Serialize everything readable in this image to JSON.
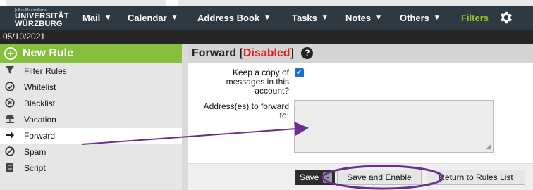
{
  "header": {
    "logo_small": "Julius-Maximilians-",
    "logo_line1": "UNIVERSITÄT",
    "logo_line2": "WÜRZBURG",
    "menu": [
      {
        "label": "Mail"
      },
      {
        "label": "Calendar"
      },
      {
        "label": "Address Book"
      },
      {
        "label": "Tasks"
      },
      {
        "label": "Notes"
      },
      {
        "label": "Others"
      },
      {
        "label": "Filters"
      }
    ],
    "caret": "▼",
    "settings_icon": "gear-icon"
  },
  "datebar": {
    "date": "05/10/2021"
  },
  "sidebar": {
    "new_rule": "New Rule",
    "items": [
      {
        "label": "Filter Rules",
        "icon": "funnel-icon",
        "active": false
      },
      {
        "label": "Whitelist",
        "icon": "check-circle-icon",
        "active": false
      },
      {
        "label": "Blacklist",
        "icon": "x-circle-icon",
        "active": false
      },
      {
        "label": "Vacation",
        "icon": "umbrella-icon",
        "active": false
      },
      {
        "label": "Forward",
        "icon": "arrow-right-icon",
        "active": true
      },
      {
        "label": "Spam",
        "icon": "ban-icon",
        "active": false
      },
      {
        "label": "Script",
        "icon": "script-icon",
        "active": false
      }
    ]
  },
  "main": {
    "title_prefix": "Forward [",
    "title_status": "Disabled",
    "title_suffix": "]",
    "help": "?",
    "keep_copy_line1": "Keep a copy of",
    "keep_copy_line2": "messages in this",
    "keep_copy_line3": "account?",
    "keep_copy_checked": true,
    "address_line1": "Address(es) to forward",
    "address_line2": "to:",
    "address_value": "",
    "buttons": {
      "save": "Save",
      "save_enable": "Save and Enable",
      "return": "Return to Rules List"
    }
  },
  "colors": {
    "menubar": "#2f3942",
    "accent_green": "#86bf3c",
    "filters_active": "#96c41e",
    "disabled_red": "#e02020",
    "annotation_purple": "#6b2d8f"
  }
}
